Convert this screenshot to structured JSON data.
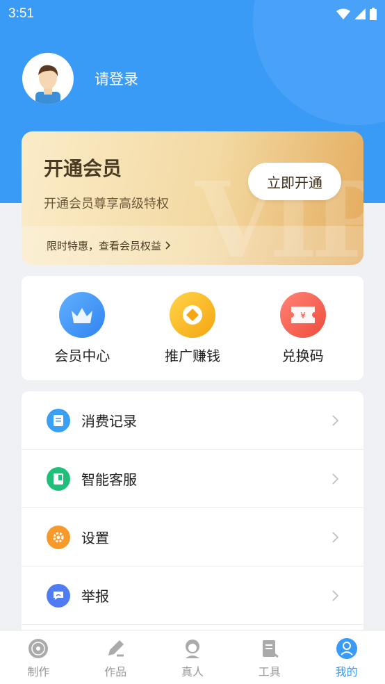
{
  "status_bar": {
    "time": "3:51"
  },
  "profile": {
    "login_text": "请登录"
  },
  "vip": {
    "title": "开通会员",
    "subtitle": "开通会员尊享高级特权",
    "button": "立即开通",
    "promo": "限时特惠，查看会员权益",
    "watermark": "VIP"
  },
  "quick_actions": [
    {
      "label": "会员中心",
      "icon": "crown-icon",
      "color": "#3d8ff5"
    },
    {
      "label": "推广赚钱",
      "icon": "coin-icon",
      "color": "#f7b61d"
    },
    {
      "label": "兑换码",
      "icon": "ticket-icon",
      "color": "#f25a4a"
    }
  ],
  "menu": [
    {
      "label": "消费记录",
      "icon": "receipt-icon",
      "color": "#3aa0f5"
    },
    {
      "label": "智能客服",
      "icon": "service-icon",
      "color": "#1fbf7a"
    },
    {
      "label": "设置",
      "icon": "gear-icon",
      "color": "#f79a2b"
    },
    {
      "label": "举报",
      "icon": "report-icon",
      "color": "#4f7cf0"
    }
  ],
  "tabs": [
    {
      "label": "制作",
      "icon": "disc-icon"
    },
    {
      "label": "作品",
      "icon": "pen-icon"
    },
    {
      "label": "真人",
      "icon": "person-icon"
    },
    {
      "label": "工具",
      "icon": "tool-icon"
    },
    {
      "label": "我的",
      "icon": "profile-icon",
      "active": true
    }
  ],
  "colors": {
    "primary": "#3a9bf7",
    "vip_gold": "#e4ac5e"
  }
}
